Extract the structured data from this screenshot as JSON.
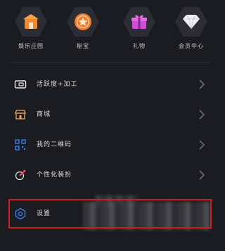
{
  "shortcuts": [
    {
      "label": "娱乐庄园",
      "icon": "house-icon",
      "color": "#f08a2c"
    },
    {
      "label": "秘宝",
      "icon": "treasure-star-icon",
      "color": "#f07a2a"
    },
    {
      "label": "礼物",
      "icon": "gift-icon",
      "color": "#d24bd8"
    },
    {
      "label": "会员中心",
      "icon": "diamond-icon",
      "color": "#f5f0f5"
    }
  ],
  "menu": [
    {
      "label": "活跃度+加工",
      "icon": "ticket-icon"
    },
    {
      "label": "商城",
      "icon": "store-icon"
    },
    {
      "label": "我的二维码",
      "icon": "qr-code-icon"
    },
    {
      "label": "个性化装扮",
      "icon": "paint-brush-icon"
    },
    {
      "label": "设置",
      "icon": "settings-hexagon-icon"
    }
  ],
  "colors": {
    "background": "#1b1c21",
    "highlight": "#d21c1c",
    "accent_blue": "#3b86ff"
  }
}
